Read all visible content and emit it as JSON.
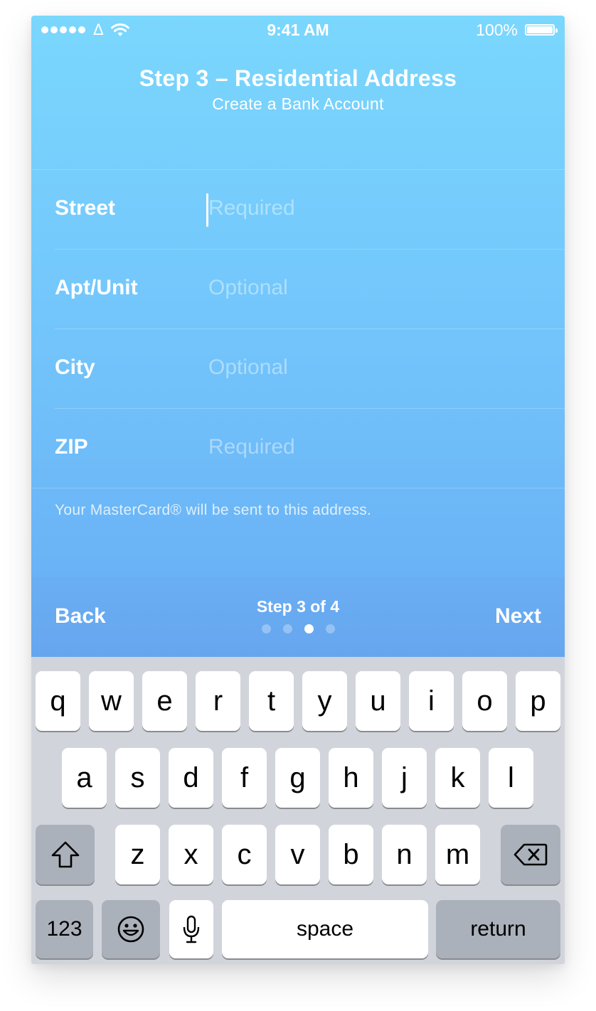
{
  "status_bar": {
    "carrier": "Δ",
    "time": "9:41 AM",
    "battery": "100%"
  },
  "header": {
    "title": "Step 3 – Residential Address",
    "subtitle": "Create a Bank Account"
  },
  "form": {
    "fields": [
      {
        "label": "Street",
        "placeholder": "Required",
        "value": "",
        "focused": true
      },
      {
        "label": "Apt/Unit",
        "placeholder": "Optional",
        "value": ""
      },
      {
        "label": "City",
        "placeholder": "Optional",
        "value": ""
      },
      {
        "label": "ZIP",
        "placeholder": "Required",
        "value": ""
      }
    ],
    "helper": "Your MasterCard® will be sent to this address."
  },
  "step_bar": {
    "back": "Back",
    "next": "Next",
    "label": "Step 3 of 4",
    "current_step": 3,
    "total_steps": 4
  },
  "keyboard": {
    "row1": [
      "q",
      "w",
      "e",
      "r",
      "t",
      "y",
      "u",
      "i",
      "o",
      "p"
    ],
    "row2": [
      "a",
      "s",
      "d",
      "f",
      "g",
      "h",
      "j",
      "k",
      "l"
    ],
    "row3": [
      "z",
      "x",
      "c",
      "v",
      "b",
      "n",
      "m"
    ],
    "numbers": "123",
    "space": "space",
    "return": "return"
  },
  "icons": {
    "shift": "shift-icon",
    "delete": "delete-icon",
    "emoji": "emoji-icon",
    "mic": "microphone-icon"
  }
}
